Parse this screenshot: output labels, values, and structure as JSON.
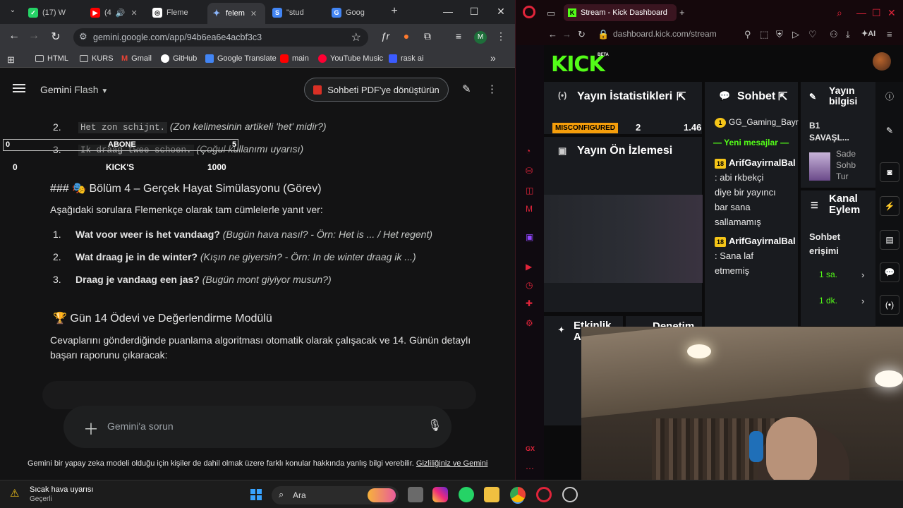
{
  "chrome": {
    "tabs": [
      {
        "label": "(17) W",
        "color": "#25d366"
      },
      {
        "label": "(4",
        "color": "#ff0000"
      },
      {
        "label": "Fleme",
        "color": "#ffffff"
      },
      {
        "label": "felem",
        "color": "#4285f4"
      },
      {
        "label": "\"stud",
        "color": "#4285f4"
      },
      {
        "label": "Goog",
        "color": "#4285f4"
      }
    ],
    "new_tab": "+",
    "url": "gemini.google.com/app/94b6ea6e4acbf3c3",
    "profile": "M",
    "bookmarks": [
      "HTML",
      "KURS",
      "Gmail",
      "GitHub",
      "Google Translate",
      "main",
      "YouTube Music",
      "rask ai"
    ],
    "bookmarks_more": "»"
  },
  "gemini": {
    "app_name": "Gemini",
    "model": "Flash",
    "pdf_button": "Sohbeti PDF'ye dönüştürün",
    "list_a": [
      {
        "n": "2.",
        "code": "Het zon schijnt.",
        "note": "(Zon kelimesinin artikeli 'het' midir?)"
      },
      {
        "n": "3.",
        "code": "Ik draag twee schoen.",
        "note": "(Çoğul kullanımı uyarısı)"
      }
    ],
    "section_heading": "### 🎭 Bölüm 4 – Gerçek Hayat Simülasyonu (Görev)",
    "section_intro": "Aşağıdaki sorulara Flemenkçe olarak tam cümlelerle yanıt ver:",
    "questions": [
      {
        "n": "1.",
        "q": "Wat voor weer is het vandaag?",
        "note": "(Bugün hava nasıl? - Örn: Het is ... / Het regent)"
      },
      {
        "n": "2.",
        "q": "Wat draag je in de winter?",
        "note": "(Kışın ne giyersin? - Örn: In de winter draag ik ...)"
      },
      {
        "n": "3.",
        "q": "Draag je vandaag een jas?",
        "note": "(Bugün mont giyiyor musun?)"
      }
    ],
    "day_heading": "🏆 Gün 14 Ödevi ve Değerlendirme Modülü",
    "day_text_1": "Cevaplarını gönderdiğinde puanlama algoritması otomatik olarak çalışacak ve 14. Günün detaylı",
    "day_text_2": "başarı raporunu çıkaracak:",
    "input_placeholder": "Gemini'a sorun",
    "disclaimer": "Gemini bir yapay zeka modeli olduğu için kişiler de dahil olmak üzere farklı konular hakkında yanlış bilgi verebilir.",
    "disclaimer_link": "Gizliliğiniz ve Gemini"
  },
  "overlay": {
    "left_val": "0",
    "label1": "ABONE",
    "right_val": "5",
    "left_val2": "0",
    "label2": "KICK'S",
    "right_val2": "1000"
  },
  "opera": {
    "tab_title": "Stream - Kick Dashboard",
    "url": "dashboard.kick.com/stream",
    "ai_label": "AI"
  },
  "kick": {
    "logo": "KICK",
    "beta": "BETA",
    "stats_title": "Yayın İstatistikleri",
    "misconfigured": "MISCONFIGURED",
    "stat_2": "2",
    "stat_3": "1.46",
    "preview_title": "Yayın Ön İzlemesi",
    "chat_title": "Sohbet",
    "chat_pinned_user": "GG_Gaming_Bayr",
    "new_messages": "Yeni mesajlar",
    "messages": [
      {
        "badge": "18",
        "user": "ArifGayirnalBal",
        "lines": [
          ": abi rkbekçi",
          "diye bir yayıncı",
          "bar sana",
          "sallamamış"
        ]
      },
      {
        "badge": "18",
        "user": "ArifGayirnalBal",
        "lines": [
          ": Sana laf",
          "etmemiş"
        ]
      }
    ],
    "info_title_1": "Yayın",
    "info_title_2": "bilgisi",
    "info_line1": "B1",
    "info_line2": "SAVAŞL...",
    "info_side1": "Sade",
    "info_side2": "Sohb",
    "info_side3": "Tur",
    "kanal_1": "Kanal",
    "kanal_2": "Eylem",
    "access_1": "Sohbet",
    "access_2": "erişimi",
    "time1": "1 sa.",
    "time2": "1 dk.",
    "activity": "Etkinlik",
    "activity2": "A",
    "moderation": "Denetim"
  },
  "taskbar": {
    "weather_title": "Sıcak hava uyarısı",
    "weather_sub": "Geçerli",
    "search": "Ara"
  },
  "colors": {
    "kick_green": "#53fc18",
    "opera_red": "#e0243a",
    "gemini_bg": "#131314"
  }
}
